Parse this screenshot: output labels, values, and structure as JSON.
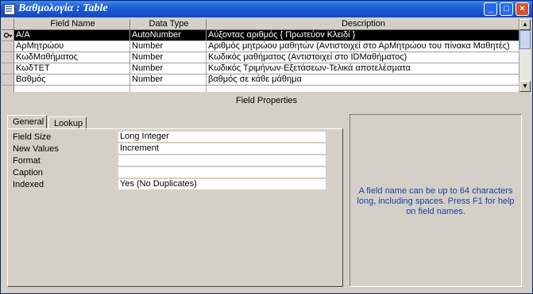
{
  "window": {
    "title": "Βαθμολογία : Table"
  },
  "titlebar_buttons": {
    "minimize": "_",
    "maximize": "□",
    "close": "×"
  },
  "grid": {
    "columns": [
      "Field Name",
      "Data Type",
      "Description"
    ],
    "rows": [
      {
        "name": "Α/Α",
        "type": "AutoNumber",
        "desc": "Αύξοντας αριθμός { Πρωτεύον Κλειδί }",
        "primary_key": true
      },
      {
        "name": "ΑρΜητρώου",
        "type": "Number",
        "desc": "Αριθμός μητρώου μαθητών (Αντιστοιχεί στο ΑρΜητρώου του πίνακα Μαθητές)"
      },
      {
        "name": "ΚωδΜαθήματος",
        "type": "Number",
        "desc": "Κωδικός μαθήματος (Αντιστοιχεί στο IDΜαθήματος)"
      },
      {
        "name": "ΚωδΤΕΤ",
        "type": "Number",
        "desc": "Κωδικός Τριμήνων-Εξετάσεων-Τελικά αποτελέσματα"
      },
      {
        "name": "Βαθμός",
        "type": "Number",
        "desc": "βαθμός σε κάθε μάθημα"
      }
    ]
  },
  "field_properties": {
    "label": "Field Properties",
    "tabs": [
      "General",
      "Lookup"
    ],
    "active_tab": "General",
    "props": [
      {
        "label": "Field Size",
        "value": "Long Integer"
      },
      {
        "label": "New Values",
        "value": "Increment"
      },
      {
        "label": "Format",
        "value": ""
      },
      {
        "label": "Caption",
        "value": ""
      },
      {
        "label": "Indexed",
        "value": "Yes (No Duplicates)"
      }
    ],
    "help_text": "A field name can be up to 64 characters long, including spaces.  Press F1 for help on field names."
  },
  "colors": {
    "titlebar": "#1f5fd6",
    "selected_row": "#000000",
    "help_text": "#1b3fa0",
    "window_bg": "#d4d0c8"
  }
}
